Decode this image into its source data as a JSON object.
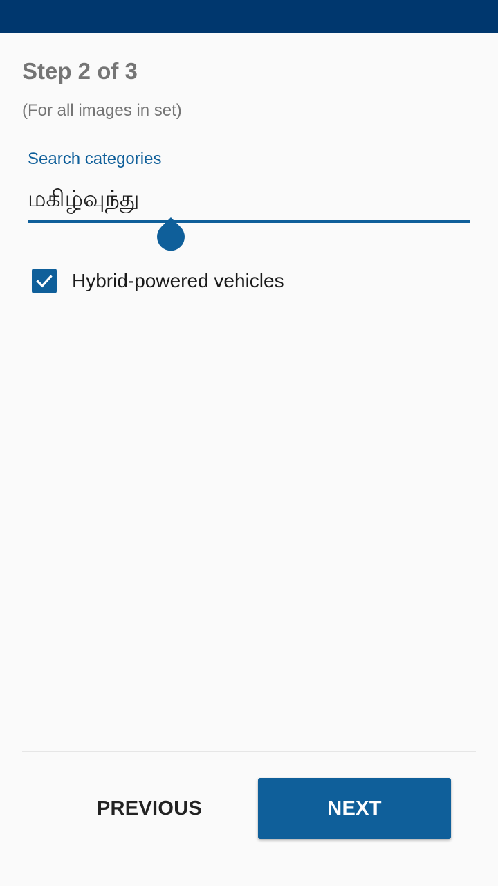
{
  "header": {
    "step_title": "Step 2 of 3",
    "step_subtitle": "(For all images in set)"
  },
  "search": {
    "label": "Search categories",
    "value": "மகிழ்வுந்து"
  },
  "results": [
    {
      "label": "Hybrid-powered vehicles",
      "checked": true
    }
  ],
  "footer": {
    "previous_label": "PREVIOUS",
    "next_label": "NEXT"
  },
  "colors": {
    "status_bar": "#00376e",
    "accent": "#0f5f9a",
    "secondary_text": "#757575",
    "background": "#fafafa"
  }
}
